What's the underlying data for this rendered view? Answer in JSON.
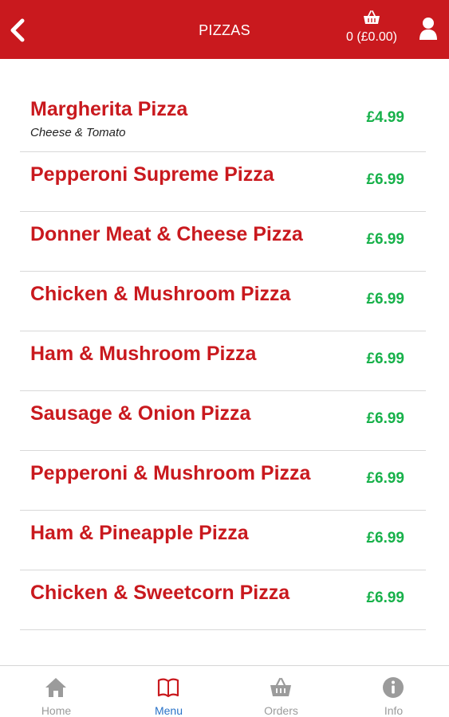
{
  "header": {
    "title": "PIZZAS",
    "basket_label": "0 (£0.00)",
    "colors": {
      "bar": "#c9191e",
      "text": "#ffffff"
    }
  },
  "menu": {
    "items": [
      {
        "name": "Margherita Pizza",
        "description": "Cheese & Tomato",
        "price": "£4.99"
      },
      {
        "name": "Pepperoni Supreme Pizza",
        "price": "£6.99"
      },
      {
        "name": "Donner Meat & Cheese Pizza",
        "price": "£6.99"
      },
      {
        "name": "Chicken & Mushroom Pizza",
        "price": "£6.99"
      },
      {
        "name": "Ham & Mushroom Pizza",
        "price": "£6.99"
      },
      {
        "name": "Sausage & Onion Pizza",
        "price": "£6.99"
      },
      {
        "name": "Pepperoni & Mushroom Pizza",
        "price": "£6.99"
      },
      {
        "name": "Ham & Pineapple Pizza",
        "price": "£6.99"
      },
      {
        "name": "Chicken & Sweetcorn Pizza",
        "price": "£6.99"
      }
    ],
    "colors": {
      "name": "#c9191e",
      "price": "#17b14a"
    }
  },
  "bottom_nav": {
    "items": [
      {
        "label": "Home",
        "icon": "home-icon"
      },
      {
        "label": "Menu",
        "icon": "book-icon",
        "active": true
      },
      {
        "label": "Orders",
        "icon": "basket-icon"
      },
      {
        "label": "Info",
        "icon": "info-icon"
      }
    ],
    "colors": {
      "active": "#2a73c8",
      "inactive": "#9b9b9b"
    }
  }
}
